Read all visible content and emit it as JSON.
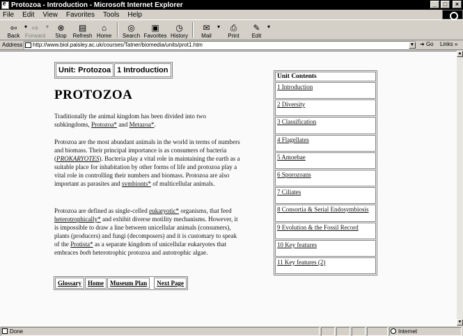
{
  "window": {
    "title": "Protozoa - Introduction - Microsoft Internet Explorer",
    "controls": [
      "_",
      "□",
      "×"
    ]
  },
  "menu": [
    "File",
    "Edit",
    "View",
    "Favorites",
    "Tools",
    "Help"
  ],
  "toolbar": {
    "buttons": [
      {
        "label": "Back",
        "icon": "back-arrow-icon"
      },
      {
        "label": "Forward",
        "icon": "forward-arrow-icon",
        "disabled": true
      },
      {
        "label": "Stop",
        "icon": "stop-icon"
      },
      {
        "label": "Refresh",
        "icon": "refresh-icon"
      },
      {
        "label": "Home",
        "icon": "home-icon"
      },
      {
        "label": "Search",
        "icon": "search-icon"
      },
      {
        "label": "Favorites",
        "icon": "favorites-icon"
      },
      {
        "label": "History",
        "icon": "history-icon"
      },
      {
        "label": "Mail",
        "icon": "mail-icon"
      },
      {
        "label": "Print",
        "icon": "print-icon"
      },
      {
        "label": "Edit",
        "icon": "edit-icon"
      }
    ]
  },
  "address": {
    "label": "Address",
    "url": "http://www.biol.paisley.ac.uk/courses/Tatner/biomedia/units/prot1.htm",
    "go_label": "Go",
    "links_label": "Links »"
  },
  "page": {
    "unit_label": "Unit: Protozoa",
    "section_label": "1 Introduction",
    "title": "PROTOZOA",
    "para1": {
      "t1": "Traditionally the animal kingdom has been divided into two subkingdoms, ",
      "l1": "Protozoa*",
      "t2": " and ",
      "l2": "Metazoa*",
      "t3": "."
    },
    "para2": {
      "t1": "Protozoa are the most abundant animals in the world in terms of numbers and biomass. Their principal importance is as consumers of bacteria (",
      "l1": "PROKARYOTES",
      "t2": "). Bacteria play a vital role in maintaining the earth as a suitable place for inhabitation by other forms of life and protozoa play a vital role in controlling their numbers and biomass. Protozoa are also important as parasites and ",
      "l2": "symbionts*",
      "t3": " of multicellular animals."
    },
    "para3": {
      "t1": "Protozoa are defined as single-celled ",
      "l1": "eukaryotic*",
      "t2": " organisms, that feed ",
      "l2": "heterotrophically*",
      "t3": " and exhibit diverse motility mechanisms. However, it is impossible to draw a line between unicellular animals (consumers), plants (producers) and fungi (decomposers) and it is customary to speak of the ",
      "l3": "Protista*",
      "t4": " as a separate kingdom of unicellular eukaryotes that embraces ",
      "em": "both",
      "t5": " heterotrophic protozoa and autotrophic algae."
    },
    "nav": [
      "Glossary",
      "Home",
      "Museum Plan",
      "Next Page"
    ],
    "contents": {
      "heading": "Unit Contents",
      "items": [
        "1 Introduction",
        "2 Diversity",
        "3 Classification",
        "4 Flagellates",
        "5 Amoebae",
        "6 Sporozoans",
        "7 Ciliates",
        "8 Consortia & Serial Endosymbiosis",
        "9 Evolution & the Fossil Record",
        "10 Key features",
        "11 Key features (2)"
      ]
    }
  },
  "status": {
    "text": "Done",
    "zone": "Internet"
  }
}
